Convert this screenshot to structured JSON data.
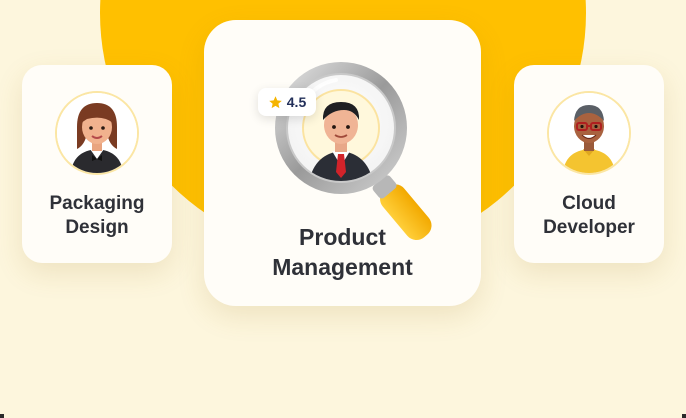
{
  "cards": {
    "left": {
      "line1": "Packaging",
      "line2": "Design"
    },
    "center": {
      "line1": "Product",
      "line2": "Management",
      "rating": "4.5"
    },
    "right": {
      "line1": "Cloud",
      "line2": "Developer"
    }
  },
  "icons": {
    "left_avatar": "woman-avatar-icon",
    "center_avatar": "businessman-avatar-icon",
    "right_avatar": "man-with-glasses-avatar-icon",
    "magnifier": "magnifying-glass-icon",
    "rating": "star-icon"
  },
  "colors": {
    "background": "#fdf6dd",
    "accent": "#ffc000",
    "card": "#fffdf8",
    "text": "#2f3138",
    "rating_text": "#23305a"
  }
}
